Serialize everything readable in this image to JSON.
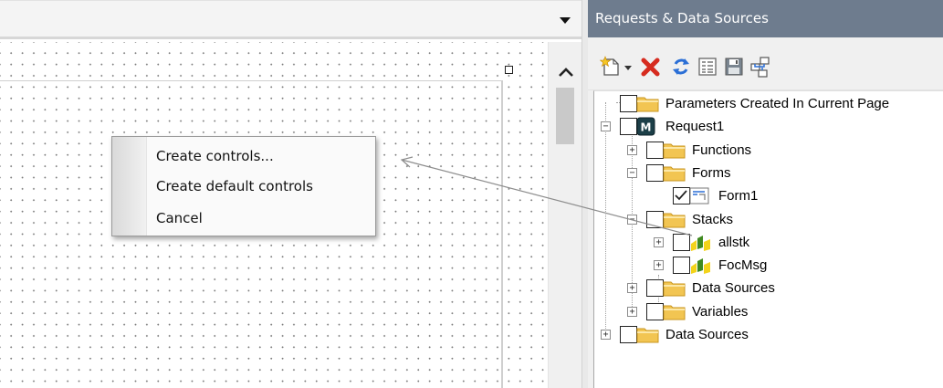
{
  "context_menu": {
    "items": [
      {
        "label": "Create controls..."
      },
      {
        "label": "Create default controls"
      },
      {
        "label": "Cancel"
      }
    ]
  },
  "panel": {
    "title": "Requests & Data Sources",
    "toolbar": [
      {
        "icon": "new-item-icon"
      },
      {
        "icon": "dropdown-arrow-icon"
      },
      {
        "icon": "delete-icon"
      },
      {
        "icon": "refresh-icon"
      },
      {
        "icon": "properties-icon"
      },
      {
        "icon": "save-icon"
      },
      {
        "icon": "hierarchy-icon"
      }
    ]
  },
  "tree": {
    "nodes": [
      {
        "label": "Parameters Created In Current Page",
        "icon": "folder-icon",
        "expander": "",
        "checked": false
      },
      {
        "label": "Request1",
        "icon": "master-file-icon",
        "expander": "−",
        "checked": false
      },
      {
        "label": "Functions",
        "icon": "folder-icon",
        "expander": "+",
        "checked": false
      },
      {
        "label": "Forms",
        "icon": "folder-icon",
        "expander": "−",
        "checked": false
      },
      {
        "label": "Form1",
        "icon": "form-icon",
        "expander": "",
        "checked": true
      },
      {
        "label": "Stacks",
        "icon": "folder-icon",
        "expander": "−",
        "checked": false
      },
      {
        "label": "allstk",
        "icon": "stack-icon",
        "expander": "+",
        "checked": false
      },
      {
        "label": "FocMsg",
        "icon": "stack-icon",
        "expander": "+",
        "checked": false
      },
      {
        "label": "Data Sources",
        "icon": "folder-icon",
        "expander": "+",
        "checked": false
      },
      {
        "label": "Variables",
        "icon": "folder-icon",
        "expander": "+",
        "checked": false
      },
      {
        "label": "Data Sources",
        "icon": "folder-icon",
        "expander": "+",
        "checked": false
      }
    ]
  },
  "colors": {
    "panel_title_bg": "#6e7c8e",
    "folder_fill": "#f2c552",
    "delete_red": "#d62b1f",
    "refresh_blue": "#2b6fd6",
    "stack_yellow": "#f3d31a",
    "stack_green": "#3f8a1f"
  }
}
